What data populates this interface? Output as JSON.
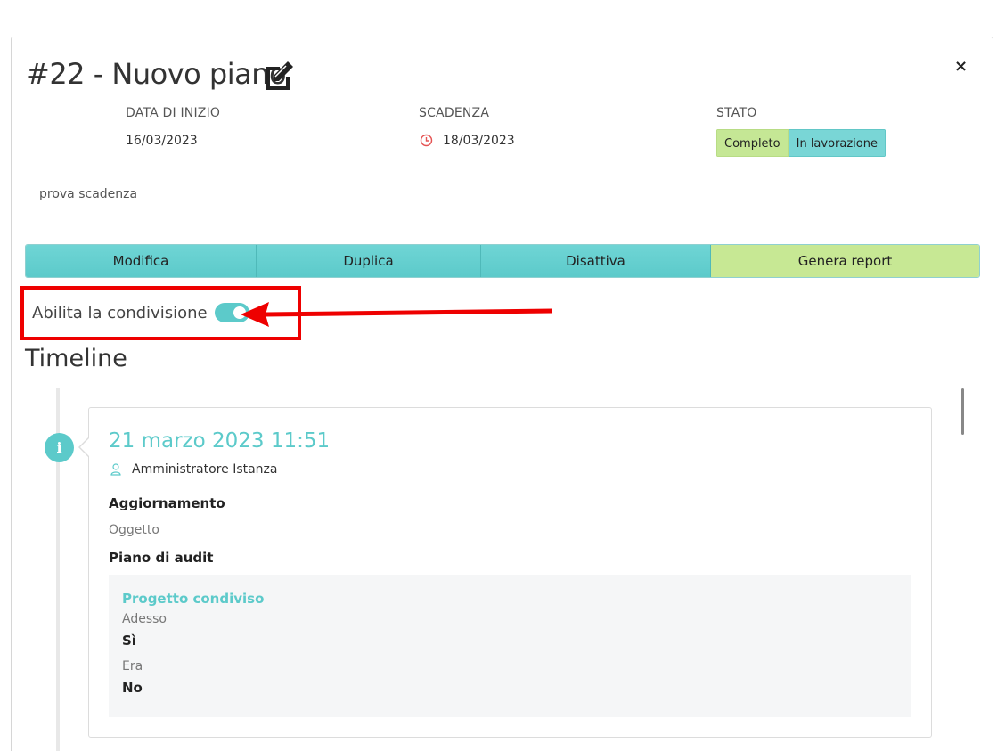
{
  "modal": {
    "title": "#22 - Nuovo piano",
    "close_label": "×",
    "meta": {
      "start_label": "DATA DI INIZIO",
      "start_value": "16/03/2023",
      "deadline_label": "SCADENZA",
      "deadline_value": "18/03/2023",
      "status_label": "STATO",
      "status_badges": [
        "Completo",
        "In lavorazione"
      ]
    },
    "description": "prova scadenza",
    "actions": [
      "Modifica",
      "Duplica",
      "Disattiva",
      "Genera report"
    ],
    "share": {
      "label": "Abilita la condivisione",
      "enabled": true
    },
    "timeline_heading": "Timeline",
    "timeline": [
      {
        "date": "21 marzo 2023 11:51",
        "user": "Amministratore Istanza",
        "type": "Aggiornamento",
        "object_label": "Oggetto",
        "object_value": "Piano di audit",
        "change": {
          "field": "Progetto condiviso",
          "now_label": "Adesso",
          "now_value": "Sì",
          "was_label": "Era",
          "was_value": "No"
        }
      }
    ]
  },
  "colors": {
    "accent": "#5ccaca",
    "complete": "#c5e795",
    "annotation": "#ee0000",
    "deadline_icon": "#e55353"
  },
  "icons": {
    "edit": "edit-icon",
    "close": "close-icon",
    "deadline": "clock-icon",
    "timeline_entry": "info-icon",
    "user": "user-icon"
  }
}
